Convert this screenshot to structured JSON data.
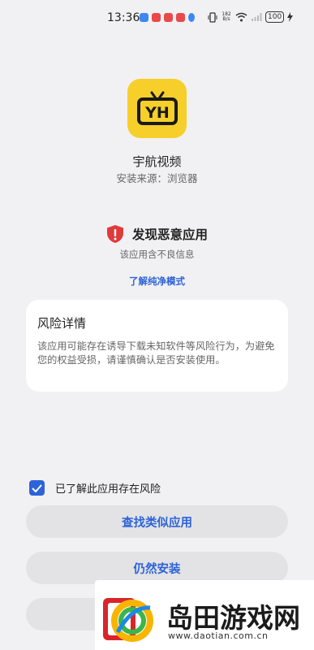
{
  "status_bar": {
    "time": "13:36",
    "net_speed": "182 B/s",
    "battery": "100",
    "icons": [
      "sim-icon",
      "vibrate-icon",
      "wifi-icon",
      "signal-icon",
      "battery-icon",
      "charging-icon"
    ]
  },
  "app": {
    "icon_text": "YH",
    "icon_color": "#f6cf2a",
    "name": "宇航视频",
    "source": "安装来源：浏览器"
  },
  "warning": {
    "title": "发现恶意应用",
    "subtitle": "该应用含不良信息",
    "link": "了解纯净模式",
    "shield_color": "#e03a3a"
  },
  "risk": {
    "title": "风险详情",
    "body": "该应用可能存在诱导下载未知软件等风险行为，为避免您的权益受损，请谨慎确认是否安装使用。"
  },
  "acknowledge": {
    "label": "已了解此应用存在风险",
    "checked": true
  },
  "buttons": {
    "find_similar": "查找类似应用",
    "install_anyway": "仍然安装"
  },
  "watermark": {
    "text": "岛田游戏网",
    "url": "www.daotian.com.cn"
  },
  "accent": "#2e63d8"
}
